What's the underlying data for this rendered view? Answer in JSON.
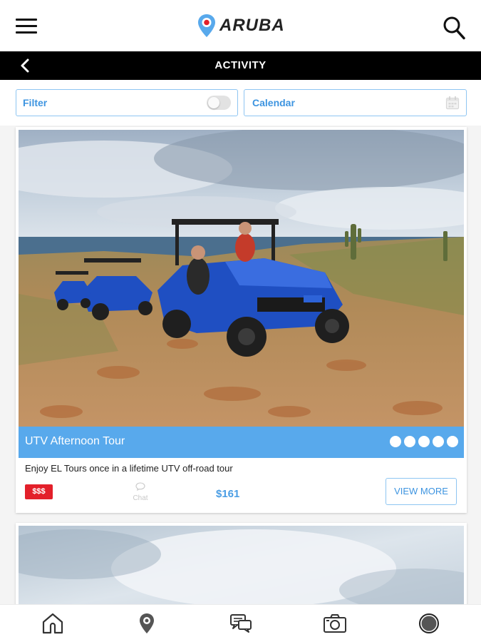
{
  "header": {
    "logo_text": "ARUBA",
    "menu_icon": "hamburger-menu-icon",
    "search_icon": "search-icon"
  },
  "titlebar": {
    "title": "ACTIVITY",
    "back_icon": "chevron-left-icon"
  },
  "filters": {
    "filter_label": "Filter",
    "filter_toggle_on": false,
    "calendar_label": "Calendar",
    "calendar_icon": "calendar-icon"
  },
  "cards": [
    {
      "title": "UTV Afternoon Tour",
      "rating_dots": 5,
      "description": "Enjoy EL Tours once in a lifetime UTV off-road tour",
      "price_level": "$$$",
      "chat_label": "Chat",
      "price": "$161",
      "view_more_label": "VIEW MORE"
    }
  ],
  "bottom_nav": [
    {
      "icon": "home-icon"
    },
    {
      "icon": "location-pin-icon"
    },
    {
      "icon": "chat-bubbles-icon"
    },
    {
      "icon": "camera-icon"
    },
    {
      "icon": "record-circle-icon"
    }
  ],
  "colors": {
    "accent_blue": "#58a9ec",
    "label_blue": "#3d94e0",
    "badge_red": "#e3202a",
    "titlebar_black": "#000000"
  }
}
